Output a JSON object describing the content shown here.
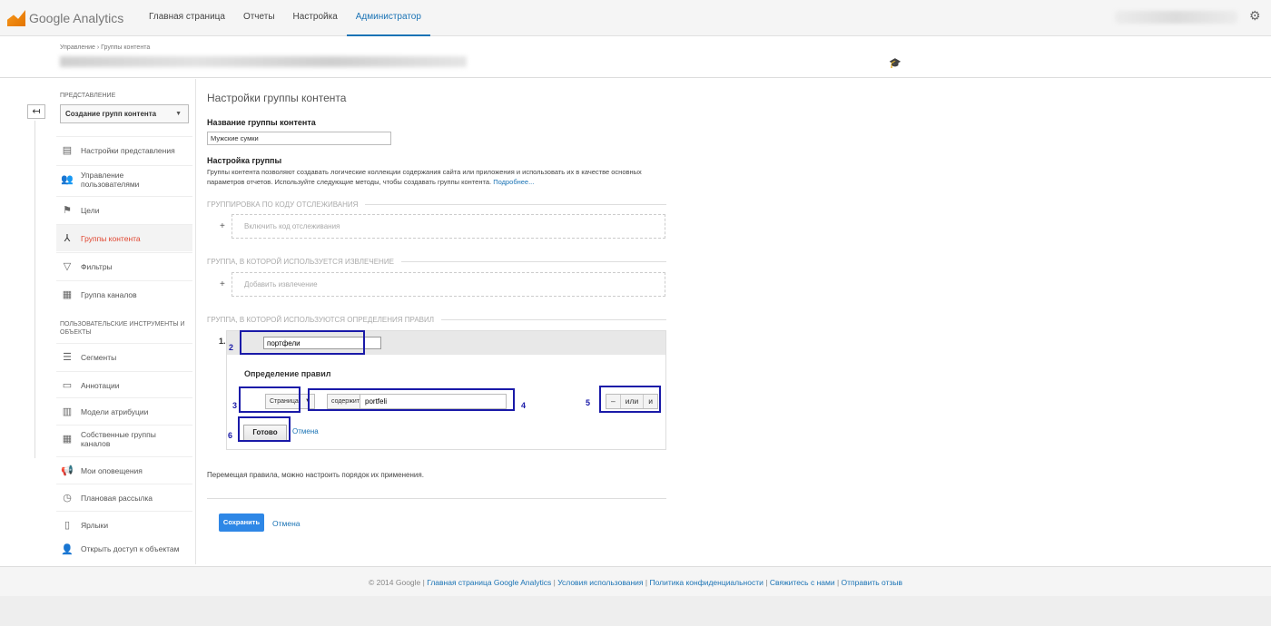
{
  "app": {
    "title": "Google Analytics"
  },
  "nav": {
    "items": [
      "Главная страница",
      "Отчеты",
      "Настройка",
      "Администратор"
    ],
    "active": "Администратор"
  },
  "breadcrumb": "Управление › Группы контента",
  "sidebar": {
    "section_view": "ПРЕДСТАВЛЕНИЕ",
    "view_select": "Создание групп контента",
    "items": [
      {
        "label": "Настройки представления",
        "icon": "document-icon"
      },
      {
        "label": "Управление пользователями",
        "icon": "users-icon"
      },
      {
        "label": "Цели",
        "icon": "flag-icon"
      },
      {
        "label": "Группы контента",
        "icon": "content-group-icon",
        "active": true
      },
      {
        "label": "Фильтры",
        "icon": "filter-icon"
      },
      {
        "label": "Группа каналов",
        "icon": "channel-group-icon"
      }
    ],
    "section_tools": "ПОЛЬЗОВАТЕЛЬСКИЕ ИНСТРУМЕНТЫ И ОБЪЕКТЫ",
    "tools": [
      {
        "label": "Сегменты",
        "icon": "segments-icon"
      },
      {
        "label": "Аннотации",
        "icon": "annotation-icon"
      },
      {
        "label": "Модели атрибуции",
        "icon": "bar-chart-icon"
      },
      {
        "label": "Собственные группы каналов",
        "icon": "channel-group-icon"
      },
      {
        "label": "Мои оповещения",
        "icon": "megaphone-icon"
      },
      {
        "label": "Плановая рассылка",
        "icon": "clock-icon"
      },
      {
        "label": "Ярлыки",
        "icon": "shortcut-icon"
      },
      {
        "label": "Открыть доступ к объектам",
        "icon": "share-user-icon"
      }
    ]
  },
  "content": {
    "title": "Настройки группы контента",
    "name_label": "Название группы контента",
    "name_value": "Мужские сумки",
    "setup_label": "Настройка группы",
    "description": "Группы контента позволяют создавать логические коллекции содержания сайта или приложения и использовать их в качестве основных параметров отчетов. Используйте следующие методы, чтобы создавать группы контента.",
    "more_link": "Подробнее...",
    "tracking_head": "ГРУППИРОВКА ПО КОДУ ОТСЛЕЖИВАНИЯ",
    "tracking_button": "Включить код отслеживания",
    "extraction_head": "ГРУППА, В КОТОРОЙ ИСПОЛЬЗУЕТСЯ ИЗВЛЕЧЕНИЕ",
    "extraction_button": "Добавить извлечение",
    "rules_head": "ГРУППА, В КОТОРОЙ ИСПОЛЬЗУЮТСЯ ОПРЕДЕЛЕНИЯ ПРАВИЛ",
    "rule": {
      "number": "1.",
      "name_value": "портфели",
      "def_label": "Определение правил",
      "dimension": "Страница",
      "operator": "содержит",
      "value": "portfeli",
      "minus": "–",
      "or": "или",
      "and": "и",
      "done": "Готово",
      "cancel": "Отмена"
    },
    "highlights": [
      "2",
      "3",
      "4",
      "5",
      "6"
    ],
    "move_note": "Перемещая правила, можно настроить порядок их применения.",
    "save": "Сохранить",
    "cancel": "Отмена"
  },
  "footer": {
    "copyright": "© 2014 Google",
    "links": [
      "Главная страница Google Analytics",
      "Условия использования",
      "Политика конфиденциальности",
      "Свяжитесь с нами",
      "Отправить отзыв"
    ]
  }
}
